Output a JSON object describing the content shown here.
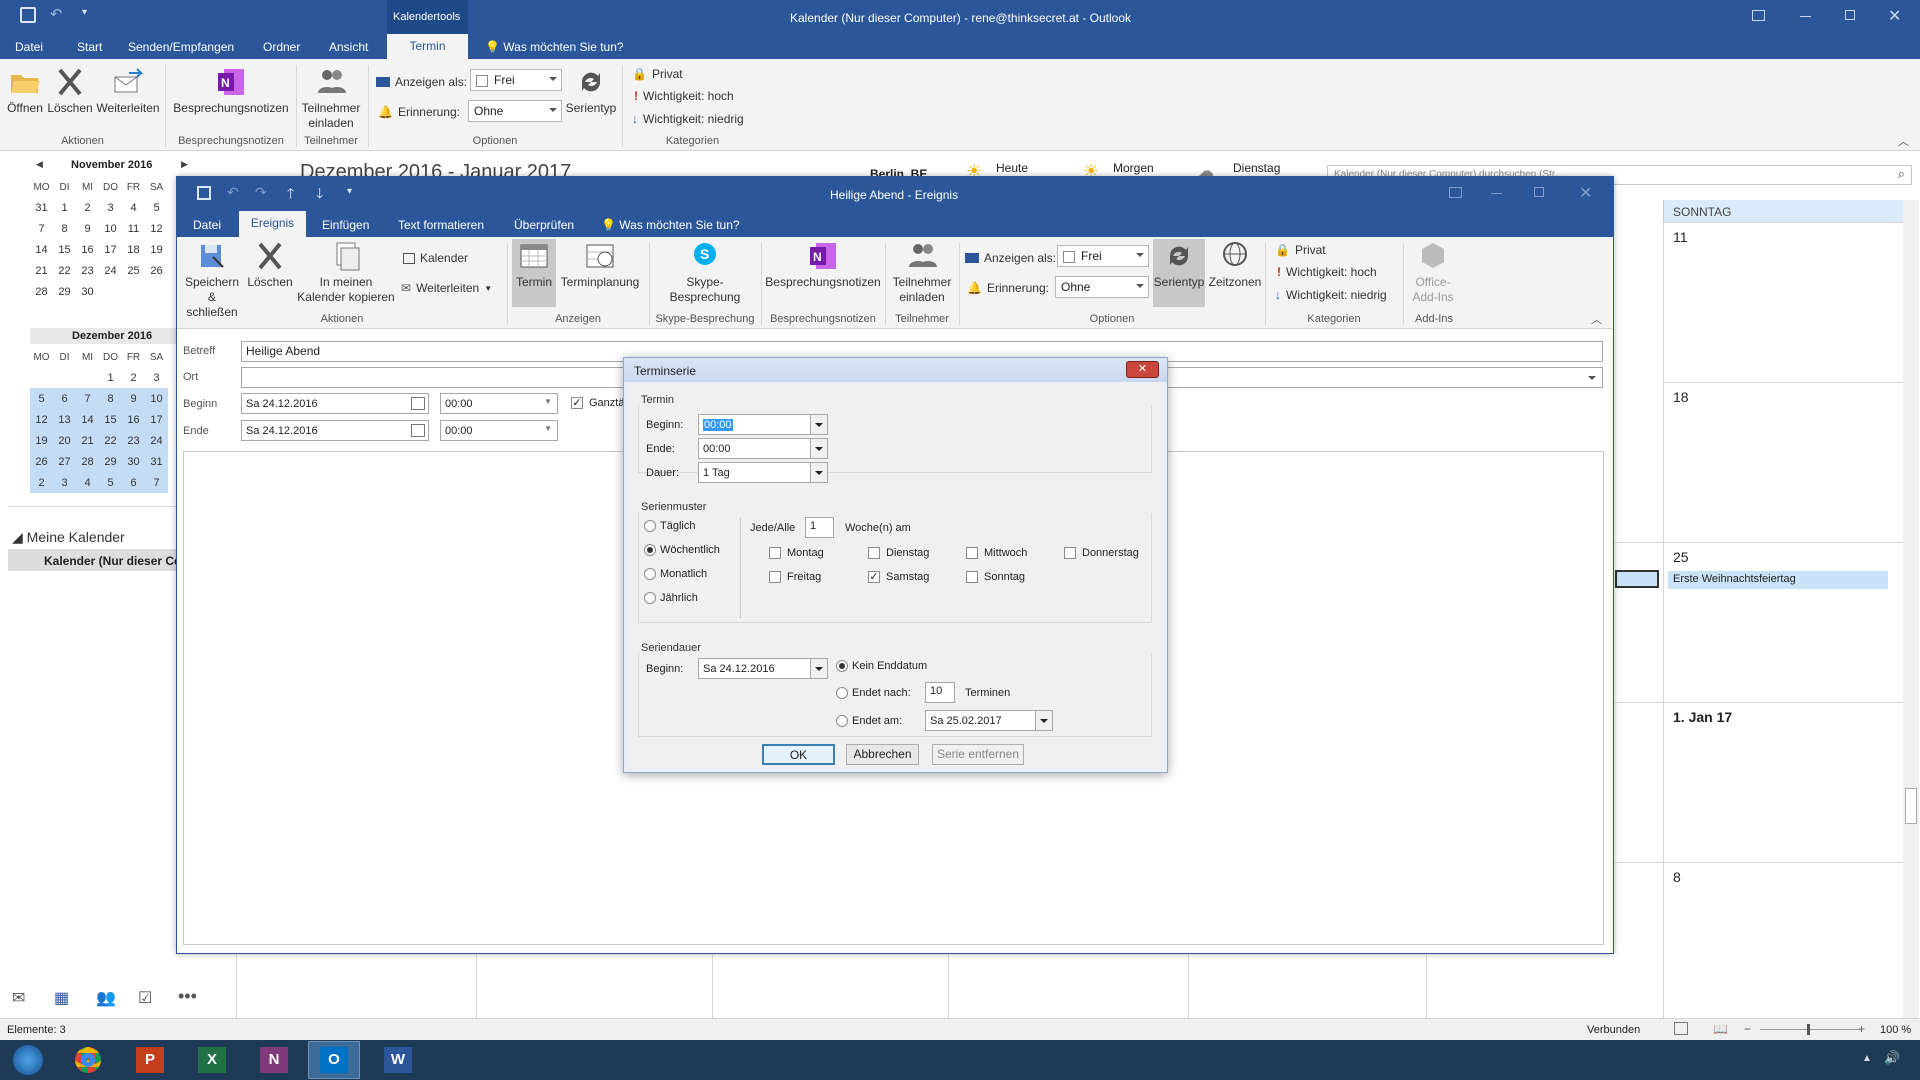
{
  "outlook": {
    "title": "Kalender (Nur dieser Computer) - rene@thinksecret.at - Outlook",
    "context_tab": "Kalendertools",
    "tabs": [
      "Datei",
      "Start",
      "Senden/Empfangen",
      "Ordner",
      "Ansicht",
      "Termin"
    ],
    "tell_me": "Was möchten Sie tun?",
    "ribbon": {
      "open": "Öffnen",
      "delete": "Löschen",
      "forward": "Weiterleiten",
      "group_actions": "Aktionen",
      "meeting_notes": "Besprechungsnotizen",
      "group_meeting_notes": "Besprechungsnotizen",
      "invite": "Teilnehmer einladen",
      "group_attendees": "Teilnehmer",
      "show_as_label": "Anzeigen als:",
      "show_as_value": "Frei",
      "reminder_label": "Erinnerung:",
      "reminder_value": "Ohne",
      "recurrence": "Serientyp",
      "group_options": "Optionen",
      "private": "Privat",
      "high": "Wichtigkeit: hoch",
      "low": "Wichtigkeit: niedrig",
      "group_categories": "Kategorien"
    },
    "calendar_header": {
      "range": "Dezember 2016 - Januar 2017",
      "weather_loc": "Berlin, BE",
      "today": "Heute",
      "tomorrow": "Morgen",
      "tuesday": "Dienstag",
      "search_placeholder": "Kalender (Nur dieser Computer) durchsuchen (Str..."
    },
    "nov": {
      "title": "November 2016",
      "days": [
        "MO",
        "DI",
        "MI",
        "DO",
        "FR",
        "SA"
      ],
      "rows": [
        [
          "31",
          "1",
          "2",
          "3",
          "4",
          "5"
        ],
        [
          "7",
          "8",
          "9",
          "10",
          "11",
          "12"
        ],
        [
          "14",
          "15",
          "16",
          "17",
          "18",
          "19"
        ],
        [
          "21",
          "22",
          "23",
          "24",
          "25",
          "26"
        ],
        [
          "28",
          "29",
          "30",
          "",
          "",
          ""
        ]
      ]
    },
    "dec": {
      "title": "Dezember 2016",
      "days": [
        "MO",
        "DI",
        "MI",
        "DO",
        "FR",
        "SA"
      ],
      "rows": [
        [
          "",
          "",
          "",
          "1",
          "2",
          "3"
        ],
        [
          "5",
          "6",
          "7",
          "8",
          "9",
          "10"
        ],
        [
          "12",
          "13",
          "14",
          "15",
          "16",
          "17"
        ],
        [
          "19",
          "20",
          "21",
          "22",
          "23",
          "24"
        ],
        [
          "26",
          "27",
          "28",
          "29",
          "30",
          "31"
        ],
        [
          "2",
          "3",
          "4",
          "5",
          "6",
          "7"
        ]
      ]
    },
    "my_calendars": "Meine Kalender",
    "calendar_item": "Kalender (Nur dieser Co",
    "sunday_header": "SONNTAG",
    "sunday_dates": [
      "11",
      "18",
      "25",
      "1. Jan 17",
      "8"
    ],
    "event_25": "Erste Weihnachtsfeiertag",
    "status_left": "Elemente: 3",
    "status_connected": "Verbunden",
    "zoom": "100 %"
  },
  "event": {
    "title": "Heilige Abend - Ereignis",
    "tabs": [
      "Datei",
      "Ereignis",
      "Einfügen",
      "Text formatieren",
      "Überprüfen"
    ],
    "tell_me": "Was möchten Sie tun?",
    "ribbon": {
      "save_close": "Speichern & schließen",
      "delete": "Löschen",
      "copy_cal": "In meinen Kalender kopieren",
      "calendar": "Kalender",
      "forward": "Weiterleiten",
      "group_actions": "Aktionen",
      "appointment": "Termin",
      "scheduling": "Terminplanung",
      "group_show": "Anzeigen",
      "skype": "Skype-Besprechung",
      "group_skype": "Skype-Besprechung",
      "notes": "Besprechungsnotizen",
      "group_notes": "Besprechungsnotizen",
      "invite": "Teilnehmer einladen",
      "group_attendees": "Teilnehmer",
      "show_as_label": "Anzeigen als:",
      "show_as_value": "Frei",
      "reminder_label": "Erinnerung:",
      "reminder_value": "Ohne",
      "recurrence": "Serientyp",
      "timezones": "Zeitzonen",
      "group_options": "Optionen",
      "private": "Privat",
      "high": "Wichtigkeit: hoch",
      "low": "Wichtigkeit: niedrig",
      "group_categories": "Kategorien",
      "addins": "Office-Add-Ins",
      "group_addins": "Add-Ins"
    },
    "form": {
      "subject_label": "Betreff",
      "subject": "Heilige Abend",
      "location_label": "Ort",
      "start_label": "Beginn",
      "start_date": "Sa 24.12.2016",
      "start_time": "00:00",
      "allday": "Ganztä",
      "end_label": "Ende",
      "end_date": "Sa 24.12.2016",
      "end_time": "00:00"
    }
  },
  "dialog": {
    "title": "Terminserie",
    "sec_time": "Termin",
    "start_label": "Beginn:",
    "start_value": "00:00",
    "end_label": "Ende:",
    "end_value": "00:00",
    "duration_label": "Dauer:",
    "duration_value": "1 Tag",
    "sec_pattern": "Serienmuster",
    "opt_daily": "Täglich",
    "opt_weekly": "Wöchentlich",
    "opt_monthly": "Monatlich",
    "opt_yearly": "Jährlich",
    "every_label": "Jede/Alle",
    "every_value": "1",
    "weeks_on": "Woche(n) am",
    "monday": "Montag",
    "tuesday": "Dienstag",
    "wednesday": "Mittwoch",
    "thursday": "Donnerstag",
    "friday": "Freitag",
    "saturday": "Samstag",
    "sunday": "Sonntag",
    "sec_range": "Seriendauer",
    "range_start_label": "Beginn:",
    "range_start_value": "Sa 24.12.2016",
    "no_end": "Kein Enddatum",
    "end_after": "Endet nach:",
    "end_after_value": "10",
    "occurrences": "Terminen",
    "end_by": "Endet am:",
    "end_by_value": "Sa 25.02.2017",
    "ok": "OK",
    "cancel": "Abbrechen",
    "remove": "Serie entfernen"
  }
}
